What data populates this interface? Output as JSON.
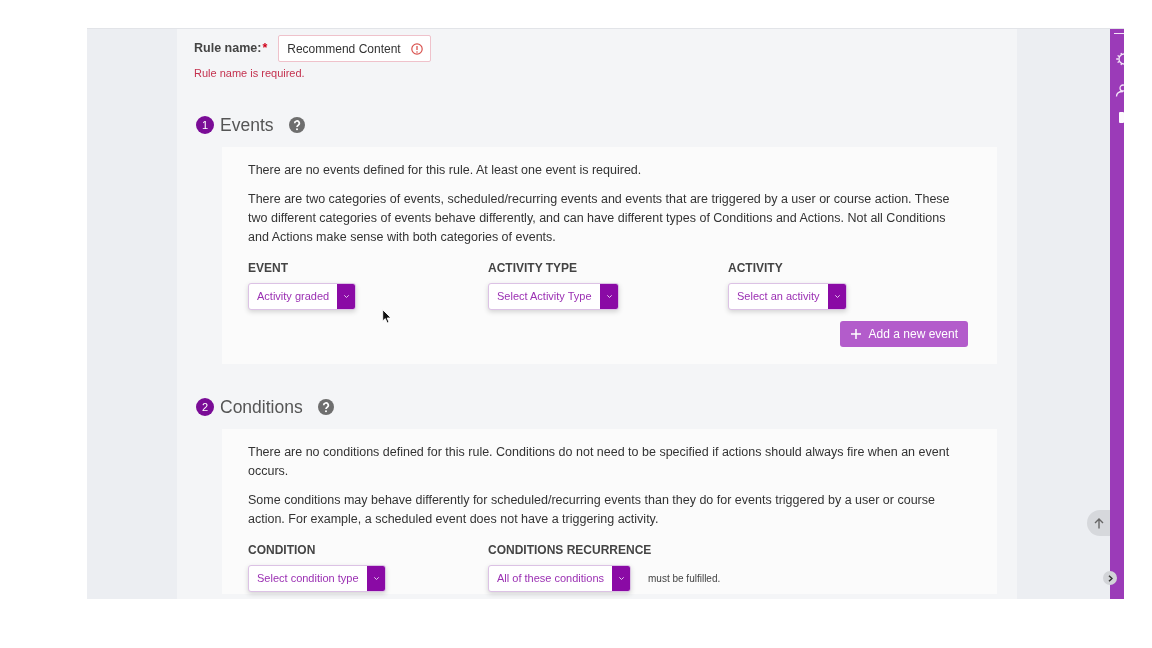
{
  "rule_name": {
    "label": "Rule name:",
    "required_mark": "*",
    "value": "Recommend Content",
    "invalid": true,
    "error": "Rule name is required."
  },
  "sections": [
    {
      "number": "1",
      "title": "Events",
      "notice": "There are no events defined for this rule. At least one event is required.",
      "description": "There are two categories of events, scheduled/recurring events and events that are triggered by a user or course action. These two different categories of events behave differently, and can have different types of Conditions and Actions. Not all Conditions and Actions make sense with both categories of events.",
      "fields": [
        {
          "label": "EVENT",
          "value": "Activity graded"
        },
        {
          "label": "ACTIVITY TYPE",
          "value": "Select Activity Type"
        },
        {
          "label": "ACTIVITY",
          "value": "Select an activity"
        }
      ],
      "add_button": "Add a new event"
    },
    {
      "number": "2",
      "title": "Conditions",
      "notice": "There are no conditions defined for this rule. Conditions do not need to be specified if actions should always fire when an event occurs.",
      "description": "Some conditions may behave differently for scheduled/recurring events than they do for events triggered by a user or course action. For example, a scheduled event does not have a triggering activity.",
      "fields": [
        {
          "label": "CONDITION",
          "value": "Select condition type"
        },
        {
          "label": "CONDITIONS RECURRENCE",
          "value": "All of these conditions",
          "suffix": "must be fulfilled."
        }
      ]
    }
  ]
}
